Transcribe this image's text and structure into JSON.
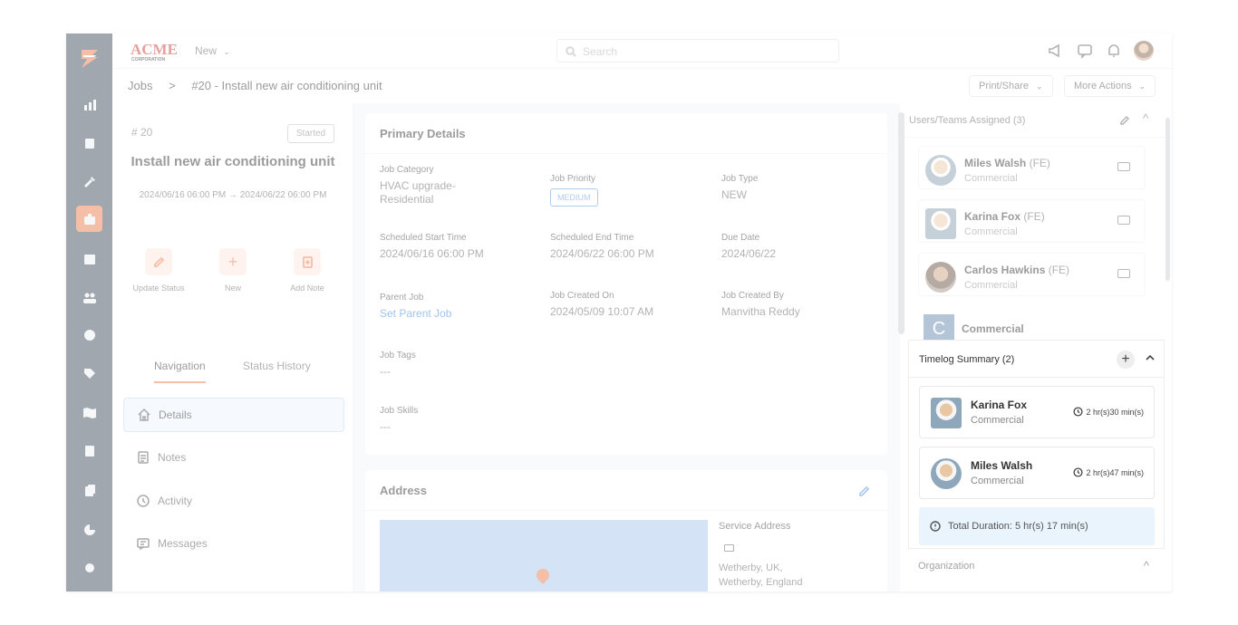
{
  "topbar": {
    "brand": "ACME",
    "brand_sub": "CORPORATION",
    "new_label": "New",
    "search_placeholder": "Search"
  },
  "breadcrumb": {
    "root": "Jobs",
    "separator": ">",
    "current": "#20 - Install new air conditioning unit"
  },
  "actions": {
    "print_share": "Print/Share",
    "more_actions": "More Actions"
  },
  "job": {
    "number": "# 20",
    "status": "Started",
    "title": "Install new air conditioning unit",
    "dates": "2024/06/16 06:00 PM → 2024/06/22 06:00 PM"
  },
  "quick_actions": [
    {
      "label": "Update Status"
    },
    {
      "label": "New"
    },
    {
      "label": "Add Note"
    }
  ],
  "tabs": {
    "navigation": "Navigation",
    "status_history": "Status History"
  },
  "nav_items": [
    {
      "label": "Details"
    },
    {
      "label": "Notes"
    },
    {
      "label": "Activity"
    },
    {
      "label": "Messages"
    }
  ],
  "primary": {
    "title": "Primary Details",
    "job_category_label": "Job Category",
    "job_category": "HVAC upgrade-Residential",
    "job_priority_label": "Job Priority",
    "job_priority": "MEDIUM",
    "job_type_label": "Job Type",
    "job_type": "NEW",
    "start_label": "Scheduled Start Time",
    "start": "2024/06/16 06:00 PM",
    "end_label": "Scheduled End Time",
    "end": "2024/06/22 06:00 PM",
    "due_label": "Due Date",
    "due": "2024/06/22",
    "parent_label": "Parent Job",
    "parent": "Set Parent Job",
    "created_on_label": "Job Created On",
    "created_on": "2024/05/09 10:07 AM",
    "created_by_label": "Job Created By",
    "created_by": "Manvitha Reddy",
    "tags_label": "Job Tags",
    "tags": "---",
    "skills_label": "Job Skills",
    "skills": "---"
  },
  "address": {
    "title": "Address",
    "service_label": "Service Address",
    "line1": "Wetherby, UK,",
    "line2": "Wetherby, England"
  },
  "assigned": {
    "header": "Users/Teams Assigned (3)",
    "users": [
      {
        "name": "Miles Walsh",
        "role": "(FE)",
        "team": "Commercial"
      },
      {
        "name": "Karina Fox",
        "role": "(FE)",
        "team": "Commercial"
      },
      {
        "name": "Carlos Hawkins",
        "role": "(FE)",
        "team": "Commercial"
      }
    ],
    "team_initial": "C",
    "team_name": "Commercial"
  },
  "timelog": {
    "header": "Timelog Summary (2)",
    "entries": [
      {
        "name": "Karina Fox",
        "team": "Commercial",
        "duration": "2 hr(s)30 min(s)"
      },
      {
        "name": "Miles Walsh",
        "team": "Commercial",
        "duration": "2 hr(s)47 min(s)"
      }
    ],
    "total": "Total Duration: 5 hr(s) 17 min(s)"
  },
  "organization": {
    "header": "Organization"
  },
  "colors": {
    "accent": "#e8703a",
    "rail": "#2f3d4f",
    "link": "#2d7bd8"
  }
}
